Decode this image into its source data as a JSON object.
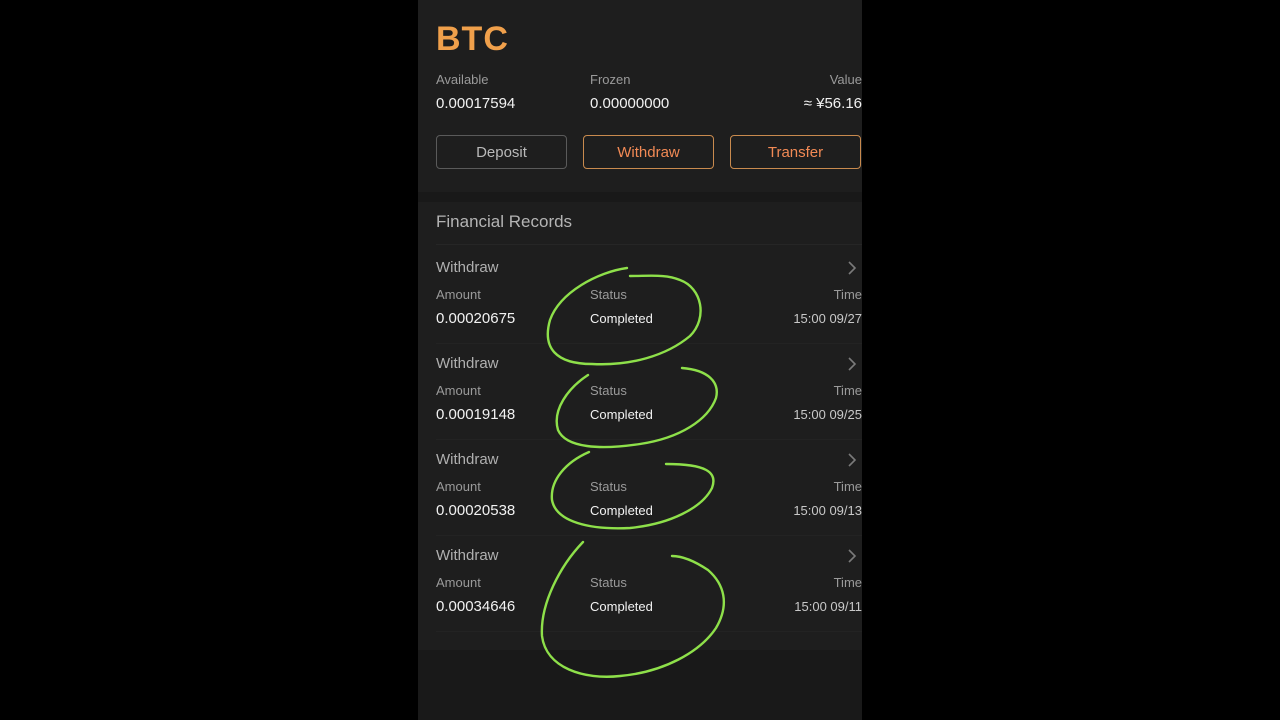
{
  "asset": {
    "coin": "BTC",
    "available_label": "Available",
    "available_value": "0.00017594",
    "frozen_label": "Frozen",
    "frozen_value": "0.00000000",
    "value_label": "Value",
    "value_value": "≈ ¥56.16"
  },
  "actions": {
    "deposit": "Deposit",
    "withdraw": "Withdraw",
    "transfer": "Transfer"
  },
  "records": {
    "title": "Financial Records",
    "items": [
      {
        "type": "Withdraw",
        "amount_label": "Amount",
        "amount": "0.00020675",
        "status_label": "Status",
        "status": "Completed",
        "time_label": "Time",
        "time": "15:00 09/27"
      },
      {
        "type": "Withdraw",
        "amount_label": "Amount",
        "amount": "0.00019148",
        "status_label": "Status",
        "status": "Completed",
        "time_label": "Time",
        "time": "15:00 09/25"
      },
      {
        "type": "Withdraw",
        "amount_label": "Amount",
        "amount": "0.00020538",
        "status_label": "Status",
        "status": "Completed",
        "time_label": "Time",
        "time": "15:00 09/13"
      },
      {
        "type": "Withdraw",
        "amount_label": "Amount",
        "amount": "0.00034646",
        "status_label": "Status",
        "status": "Completed",
        "time_label": "Time",
        "time": "15:00 09/11"
      }
    ]
  },
  "icons": {
    "record_chevron": "chevron-right-icon"
  },
  "colors": {
    "coin_accent": "#f0a04b",
    "action_accent": "#f28a55",
    "annotation": "#8ee04a",
    "background": "#1e1e1e"
  }
}
